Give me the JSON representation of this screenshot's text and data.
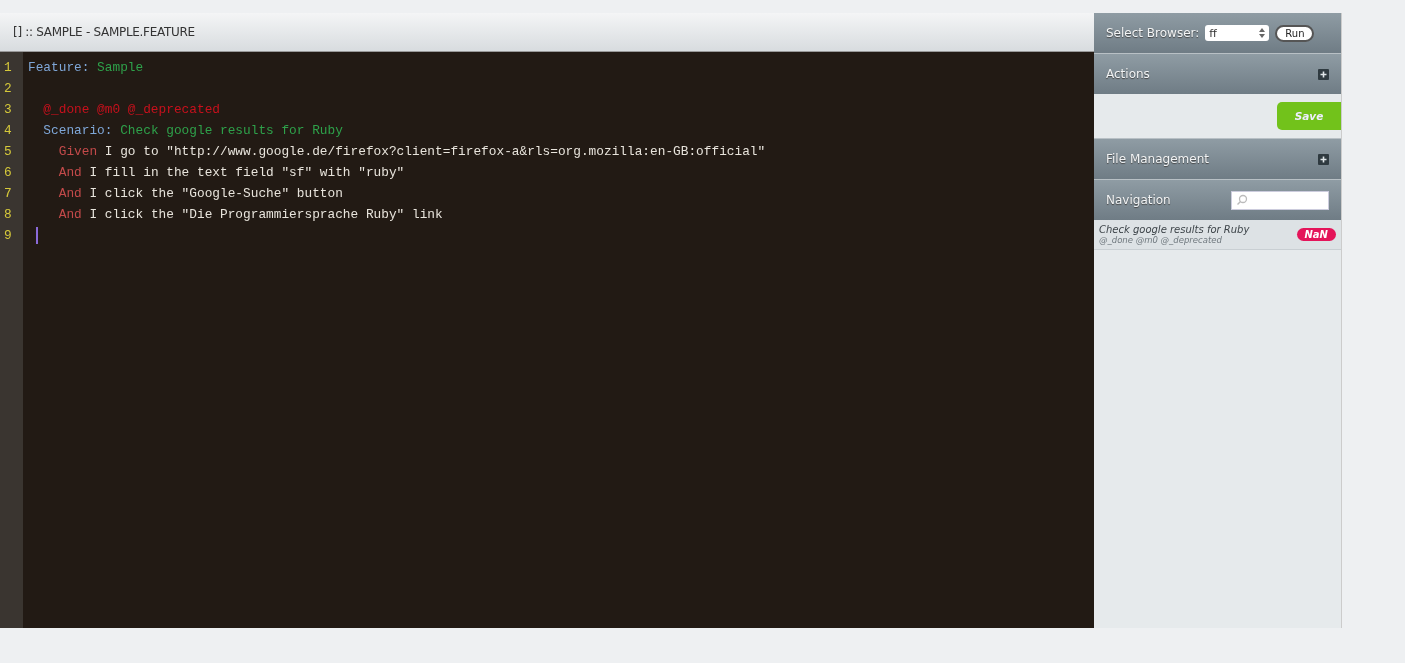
{
  "editor": {
    "title": "[] :: SAMPLE - SAMPLE.FEATURE",
    "lines": [
      {
        "number": "1",
        "cursor": false,
        "tokens": [
          {
            "kind": "keyword",
            "text": "Feature:"
          },
          {
            "kind": "name",
            "text": " Sample"
          }
        ]
      },
      {
        "number": "2",
        "cursor": false
      },
      {
        "number": "3",
        "cursor": false,
        "tokens": [
          {
            "kind": "tag",
            "text": "  @_done @m0 @_deprecated"
          }
        ]
      },
      {
        "number": "4",
        "cursor": false,
        "tokens": [
          {
            "kind": "keyword",
            "text": "  Scenario:"
          },
          {
            "kind": "name",
            "text": " Check google results for Ruby"
          }
        ]
      },
      {
        "number": "5",
        "cursor": false,
        "tokens": [
          {
            "kind": "step",
            "text": "    Given"
          },
          {
            "kind": "text",
            "text": " I go to \"http://www.google.de/firefox?client=firefox-a&rls=org.mozilla:en-GB:official\""
          }
        ]
      },
      {
        "number": "6",
        "cursor": false,
        "tokens": [
          {
            "kind": "step",
            "text": "    And"
          },
          {
            "kind": "text",
            "text": " I fill in the text field \"sf\" with \"ruby\""
          }
        ]
      },
      {
        "number": "7",
        "cursor": false,
        "tokens": [
          {
            "kind": "step",
            "text": "    And"
          },
          {
            "kind": "text",
            "text": " I click the \"Google-Suche\" button"
          }
        ]
      },
      {
        "number": "8",
        "cursor": false,
        "tokens": [
          {
            "kind": "step",
            "text": "    And"
          },
          {
            "kind": "text",
            "text": " I click the \"Die Programmiersprache Ruby\" link"
          }
        ]
      },
      {
        "number": "9",
        "cursor": true
      }
    ]
  },
  "sidebar": {
    "browser_label": "Select Browser:",
    "browser_value": "ff",
    "run_button": "Run",
    "actions": {
      "title": "Actions",
      "save_button": "Save"
    },
    "file_management": {
      "title": "File Management"
    },
    "navigation": {
      "title": "Navigation",
      "items": [
        {
          "title": "Check google results for Ruby",
          "tags": "@_done @m0 @_deprecated",
          "badge": "NaN"
        }
      ]
    }
  }
}
